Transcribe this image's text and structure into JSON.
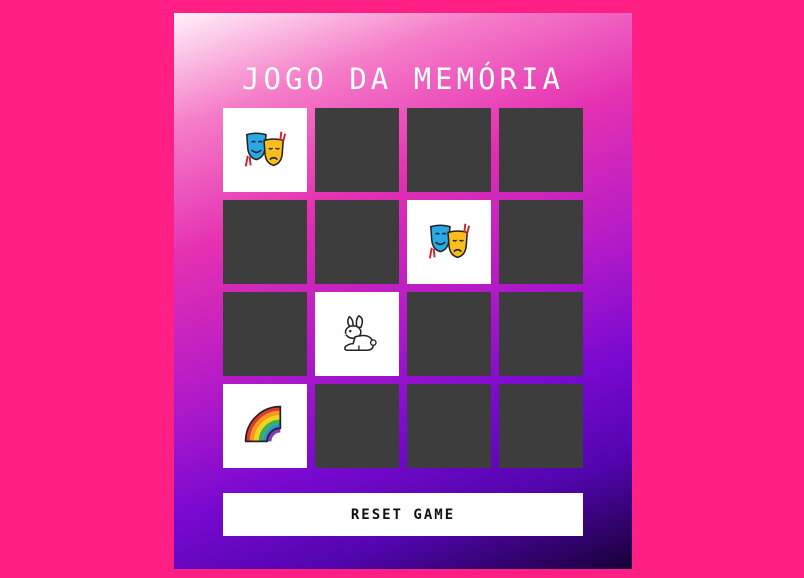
{
  "game": {
    "title": "JOGO DA MEMÓRIA",
    "reset_label": "RESET GAME",
    "cards": [
      {
        "revealed": true,
        "icon": "performing-arts-icon"
      },
      {
        "revealed": false,
        "icon": null
      },
      {
        "revealed": false,
        "icon": null
      },
      {
        "revealed": false,
        "icon": null
      },
      {
        "revealed": false,
        "icon": null
      },
      {
        "revealed": false,
        "icon": null
      },
      {
        "revealed": true,
        "icon": "performing-arts-icon"
      },
      {
        "revealed": false,
        "icon": null
      },
      {
        "revealed": false,
        "icon": null
      },
      {
        "revealed": true,
        "icon": "rabbit-icon"
      },
      {
        "revealed": false,
        "icon": null
      },
      {
        "revealed": false,
        "icon": null
      },
      {
        "revealed": true,
        "icon": "rainbow-icon"
      },
      {
        "revealed": false,
        "icon": null
      },
      {
        "revealed": false,
        "icon": null
      },
      {
        "revealed": false,
        "icon": null
      }
    ]
  },
  "colors": {
    "page_background": "#ff1f85",
    "card_hidden": "#3d3d3d",
    "card_revealed": "#ffffff"
  }
}
